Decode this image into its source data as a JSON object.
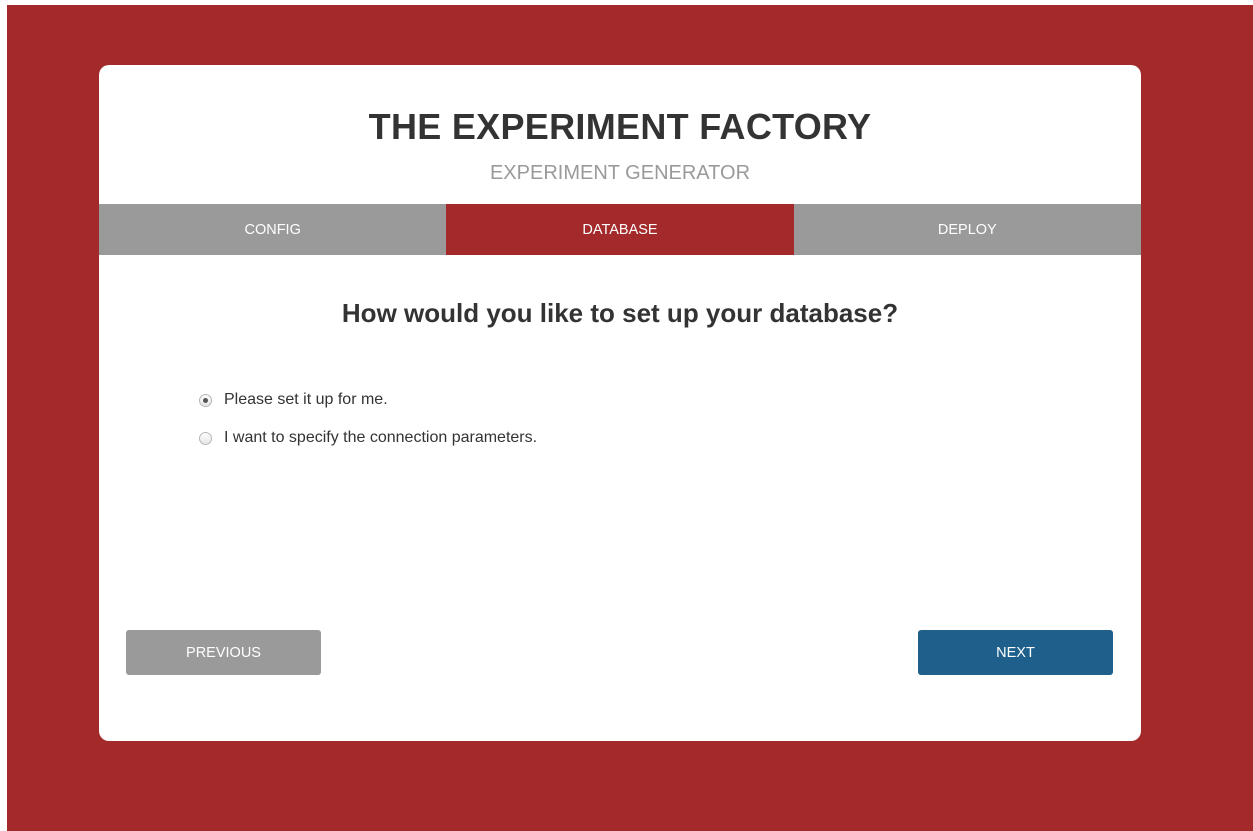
{
  "header": {
    "title": "THE EXPERIMENT FACTORY",
    "subtitle": "EXPERIMENT GENERATOR"
  },
  "tabs": [
    {
      "label": "CONFIG",
      "active": false
    },
    {
      "label": "DATABASE",
      "active": true
    },
    {
      "label": "DEPLOY",
      "active": false
    }
  ],
  "main": {
    "question": "How would you like to set up your database?",
    "options": [
      {
        "label": "Please set it up for me.",
        "checked": true
      },
      {
        "label": "I want to specify the connection parameters.",
        "checked": false
      }
    ]
  },
  "buttons": {
    "previous_label": "PREVIOUS",
    "next_label": "NEXT"
  },
  "colors": {
    "brand_red": "#a3292a",
    "tab_gray": "#9a9a9a",
    "next_blue": "#1f5f8b"
  }
}
